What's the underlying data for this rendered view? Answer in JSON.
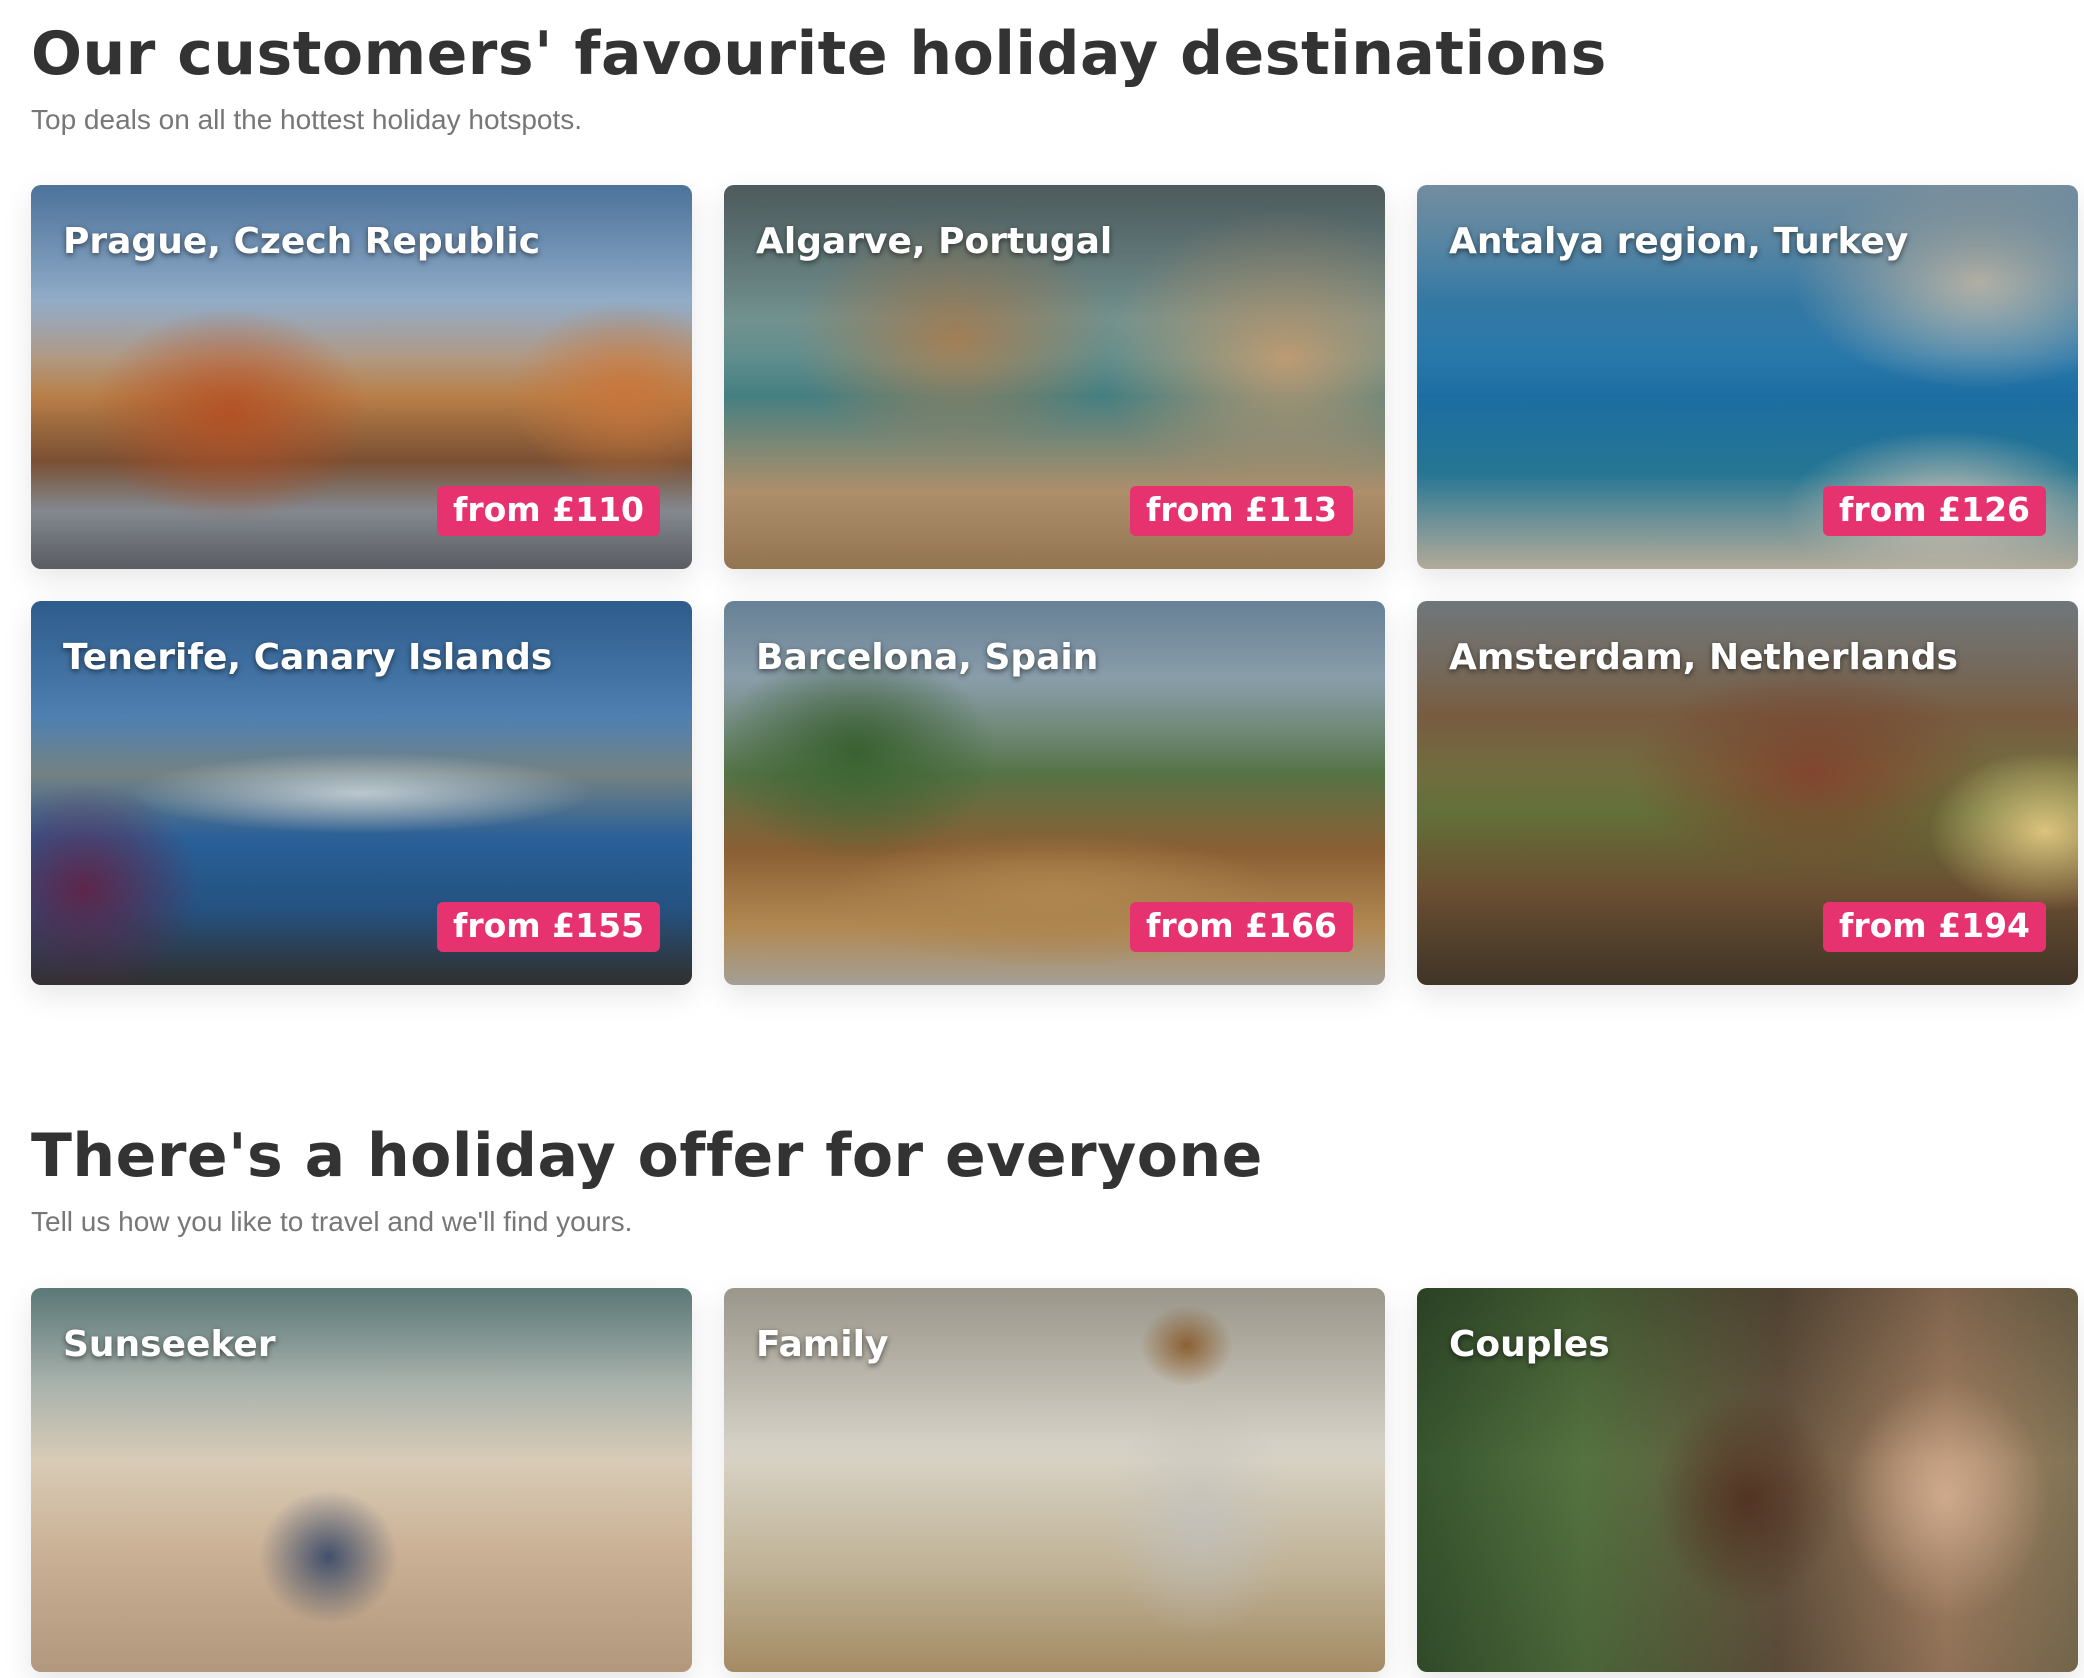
{
  "destinations_section": {
    "title": "Our customers' favourite holiday destinations",
    "subtitle": "Top deals on all the hottest holiday hotspots.",
    "cards": [
      {
        "name": "Prague, Czech Republic",
        "price": "from £110"
      },
      {
        "name": "Algarve, Portugal",
        "price": "from £113"
      },
      {
        "name": "Antalya region, Turkey",
        "price": "from £126"
      },
      {
        "name": "Tenerife, Canary Islands",
        "price": "from £155"
      },
      {
        "name": "Barcelona, Spain",
        "price": "from £166"
      },
      {
        "name": "Amsterdam, Netherlands",
        "price": "from £194"
      }
    ]
  },
  "offers_section": {
    "title": "There's a holiday offer for everyone",
    "subtitle": "Tell us how you like to travel and we'll find yours.",
    "cards": [
      {
        "name": "Sunseeker"
      },
      {
        "name": "Family"
      },
      {
        "name": "Couples"
      }
    ]
  },
  "colors": {
    "price_badge": "#e6326e",
    "heading": "#333333",
    "subtitle": "#777777"
  }
}
